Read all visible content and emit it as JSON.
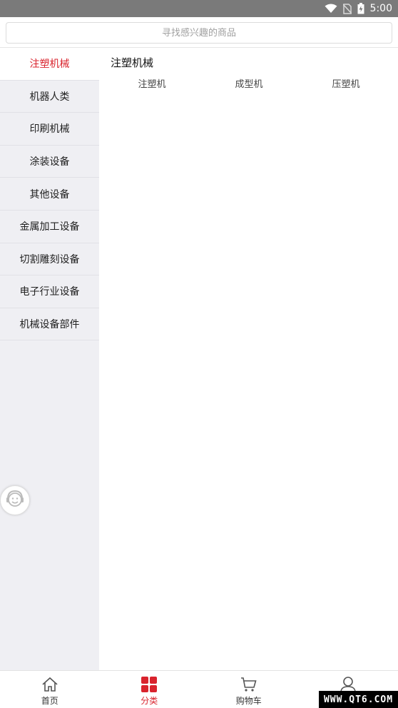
{
  "status_bar": {
    "time": "5:00",
    "icons": [
      "wifi-icon",
      "no-sim-icon",
      "battery-icon"
    ]
  },
  "search": {
    "placeholder": "寻找感兴趣的商品"
  },
  "sidebar": {
    "items": [
      {
        "label": "注塑机械",
        "active": true
      },
      {
        "label": "机器人类",
        "active": false
      },
      {
        "label": "印刷机械",
        "active": false
      },
      {
        "label": "涂装设备",
        "active": false
      },
      {
        "label": "其他设备",
        "active": false
      },
      {
        "label": "金属加工设备",
        "active": false
      },
      {
        "label": "切割雕刻设备",
        "active": false
      },
      {
        "label": "电子行业设备",
        "active": false
      },
      {
        "label": "机械设备部件",
        "active": false
      }
    ]
  },
  "content": {
    "title": "注塑机械",
    "subcategories": [
      "注塑机",
      "成型机",
      "压塑机"
    ]
  },
  "tabbar": {
    "items": [
      {
        "label": "首页",
        "icon": "home-icon",
        "active": false
      },
      {
        "label": "分类",
        "icon": "category-grid-icon",
        "active": true
      },
      {
        "label": "购物车",
        "icon": "cart-icon",
        "active": false
      },
      {
        "label": "我的",
        "icon": "user-icon",
        "active": false
      }
    ]
  },
  "watermark": {
    "text": "WWW.QT6.COM"
  },
  "colors": {
    "accent": "#d9232d",
    "sidebar_bg": "#efeff3",
    "status_bar_bg": "#7a7a7a"
  }
}
